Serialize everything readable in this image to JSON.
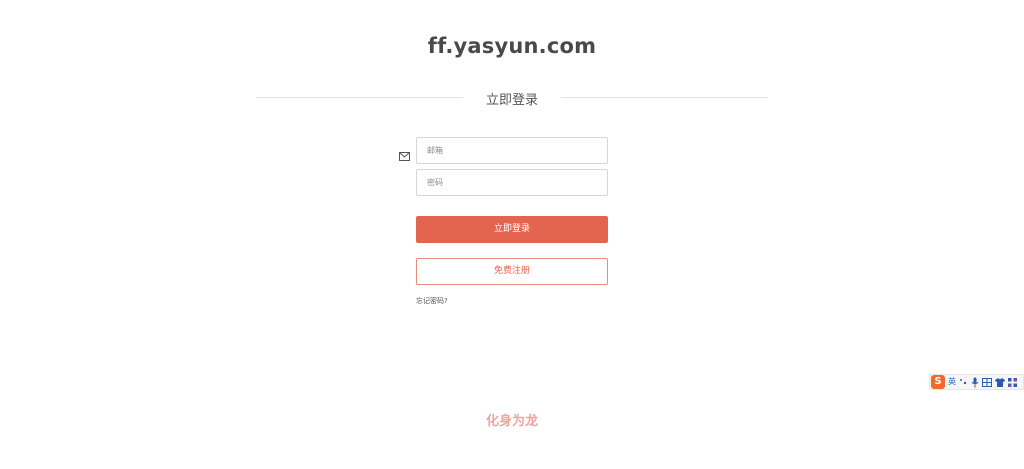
{
  "site": {
    "title": "ff.yasyun.com"
  },
  "login_form": {
    "heading": "立即登录",
    "email_placeholder": "邮箱",
    "email_icon": "mail-icon",
    "password_placeholder": "密码",
    "login_button": "立即登录",
    "register_button": "免费注册",
    "forgot_link": "忘记密码?"
  },
  "ime_toolbar": {
    "logo": "S",
    "mode": "英",
    "icons": [
      "punctuation-icon",
      "microphone-icon",
      "keyboard-icon",
      "skin-icon",
      "grid-icon"
    ]
  },
  "footer": {
    "brand": "化身为龙"
  },
  "colors": {
    "accent": "#e4654f",
    "title": "#4a4a4a",
    "footer_brand": "#f1a3a3",
    "ime_logo": "#f06a2b"
  }
}
